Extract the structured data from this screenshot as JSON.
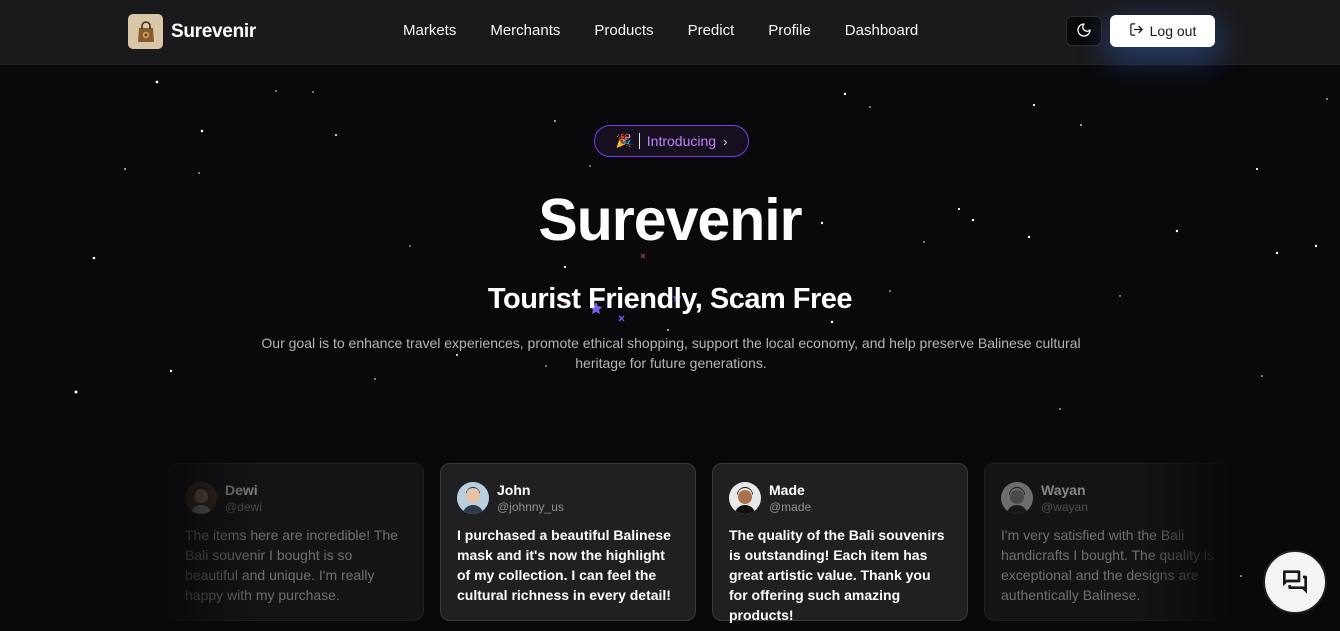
{
  "brand": {
    "name": "Surevenir",
    "logo_icon": "shopping-bag-icon"
  },
  "nav": {
    "links": [
      "Markets",
      "Merchants",
      "Products",
      "Predict",
      "Profile",
      "Dashboard"
    ],
    "theme_icon": "moon-icon",
    "logout_label": "Log out",
    "logout_icon": "log-out-icon"
  },
  "hero": {
    "badge": {
      "emoji": "🎉",
      "text": "Introducing",
      "chevron": "›"
    },
    "title": "Surevenir",
    "subtitle": "Tourist Friendly, Scam Free",
    "description": "Our goal is to enhance travel experiences, promote ethical shopping, support the local economy, and help preserve Balinese cultural heritage for future generations."
  },
  "testimonials": [
    {
      "name": "Dewi",
      "handle": "@dewi",
      "text": "The items here are incredible! The Bali souvenir I bought is so beautiful and unique. I'm really happy with my purchase."
    },
    {
      "name": "John",
      "handle": "@johnny_us",
      "text": "I purchased a beautiful Balinese mask and it's now the highlight of my collection. I can feel the cultural richness in every detail!"
    },
    {
      "name": "Made",
      "handle": "@made",
      "text": "The quality of the Bali souvenirs is outstanding! Each item has great artistic value. Thank you for offering such amazing products!"
    },
    {
      "name": "Wayan",
      "handle": "@wayan",
      "text": "I'm very satisfied with the Bali handicrafts I bought. The quality is exceptional and the designs are authentically Balinese."
    }
  ],
  "chat": {
    "icon": "chat-bubbles-icon"
  },
  "colors": {
    "accent": "#7c3aed",
    "badge_text": "#c084fc",
    "background": "#09090b",
    "navbar": "#1a1a1c"
  }
}
